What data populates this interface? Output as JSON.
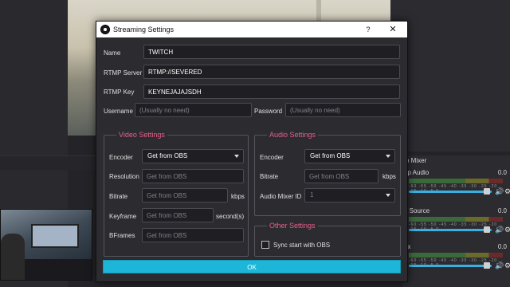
{
  "dialog": {
    "title": "Streaming Settings",
    "help": "?",
    "close": "✕",
    "name_label": "Name",
    "name_value": "TWITCH",
    "server_label": "RTMP Server",
    "server_value": "RTMP://SEVERED",
    "key_label": "RTMP Key",
    "key_value": "KEYNEJAJAJSDH",
    "username_label": "Username",
    "username_placeholder": "(Usually no need)",
    "password_label": "Password",
    "password_placeholder": "(Usually no need)",
    "video": {
      "title": "Video Settings",
      "encoder_label": "Encoder",
      "encoder_value": "Get from OBS",
      "resolution_label": "Resolution",
      "resolution_placeholder": "Get from OBS",
      "bitrate_label": "Bitrate",
      "bitrate_placeholder": "Get from OBS",
      "bitrate_unit": "kbps",
      "keyframe_label": "Keyframe",
      "keyframe_placeholder": "Get from OBS",
      "keyframe_unit": "second(s)",
      "bframes_label": "BFrames",
      "bframes_placeholder": "Get from OBS"
    },
    "audio": {
      "title": "Audio Settings",
      "encoder_label": "Encoder",
      "encoder_value": "Get from OBS",
      "bitrate_label": "Bitrate",
      "bitrate_placeholder": "Get from OBS",
      "bitrate_unit": "kbps",
      "mixer_label": "Audio Mixer ID",
      "mixer_value": "1"
    },
    "other": {
      "title": "Other Settings",
      "sync_label": "Sync start with OBS",
      "sync_checked": false
    },
    "ok": "OK"
  },
  "mixer": {
    "title": "o Mixer",
    "channels": [
      {
        "name": "op Audio",
        "db": "0.0"
      },
      {
        "name": "n Source",
        "db": "0.0"
      },
      {
        "name": "ux",
        "db": "0.0"
      }
    ],
    "ticks": "-60 -55 -50 -45 -40 -35 -30 -25 -20 -15 -10 -5 0",
    "volume_icon": "speaker-icon",
    "settings_icon": "gear-icon"
  },
  "colors": {
    "accent": "#1eb6d8",
    "group_title": "#e8608a",
    "dialog_bg": "#2b2b30",
    "field_bg": "#1f1f23"
  }
}
